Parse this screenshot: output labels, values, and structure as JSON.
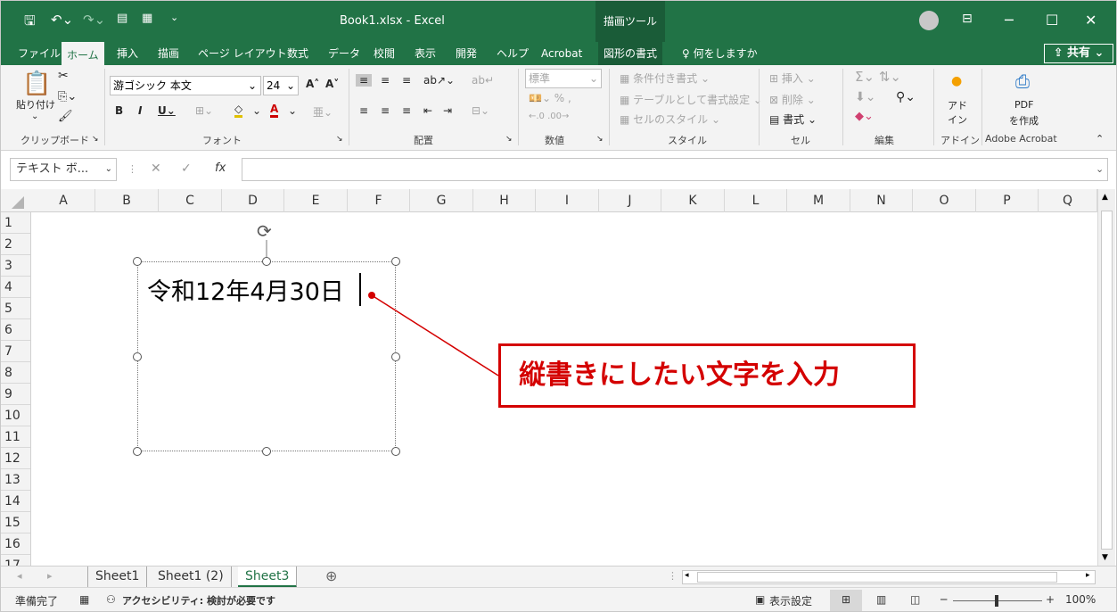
{
  "window": {
    "title": "Book1.xlsx  -  Excel",
    "drawing_tools_label": "描画ツール",
    "controls": [
      "─",
      "☐",
      "✕"
    ]
  },
  "tabs": [
    "ファイル",
    "ホーム",
    "挿入",
    "描画",
    "ページ レイアウト",
    "数式",
    "データ",
    "校閲",
    "表示",
    "開発",
    "ヘルプ",
    "Acrobat",
    "図形の書式"
  ],
  "active_tab": "ホーム",
  "tell_me": "何をしますか",
  "share_label": "共有",
  "ribbon": {
    "clipboard": {
      "paste": "貼り付け",
      "group": "クリップボード"
    },
    "font": {
      "name": "游ゴシック 本文",
      "size": "24",
      "group": "フォント"
    },
    "alignment": {
      "group": "配置"
    },
    "number": {
      "format": "標準",
      "group": "数値"
    },
    "styles": {
      "conditional": "条件付き書式",
      "table": "テーブルとして書式設定",
      "cell_styles": "セルのスタイル",
      "group": "スタイル"
    },
    "cells": {
      "insert": "挿入",
      "delete": "削除",
      "format": "書式",
      "group": "セル"
    },
    "editing": {
      "group": "編集"
    },
    "addins": {
      "label": "アド\nイン",
      "group": "アドイン"
    },
    "acrobat": {
      "label_line1": "PDF",
      "label_line2": "を作成",
      "group": "Adobe Acrobat"
    }
  },
  "formula_bar": {
    "name_box": "テキスト ボ...",
    "fx": "fx",
    "value": ""
  },
  "columns": [
    "A",
    "B",
    "C",
    "D",
    "E",
    "F",
    "G",
    "H",
    "I",
    "J",
    "K",
    "L",
    "M",
    "N",
    "O",
    "P",
    "Q"
  ],
  "rows": [
    "1",
    "2",
    "3",
    "4",
    "5",
    "6",
    "7",
    "8",
    "9",
    "10",
    "11",
    "12",
    "13",
    "14",
    "15",
    "16",
    "17"
  ],
  "textbox_text": "令和12年4月30日",
  "callout_text": "縦書きにしたい文字を入力",
  "sheets": [
    "Sheet1",
    "Sheet1 (2)",
    "Sheet3"
  ],
  "active_sheet": "Sheet3",
  "status": {
    "ready": "準備完了",
    "accessibility": "アクセシビリティ: 検討が必要です",
    "display_settings": "表示設定",
    "zoom_level": "100%"
  }
}
